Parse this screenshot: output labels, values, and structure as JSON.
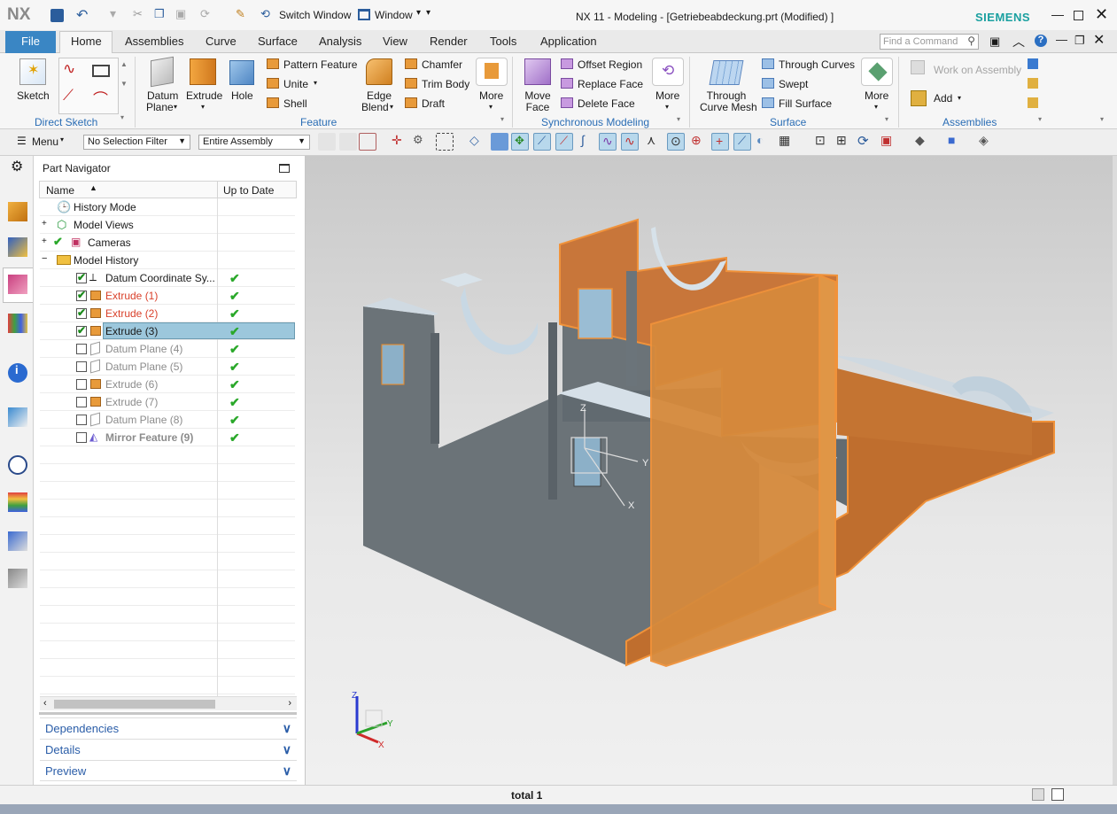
{
  "app": {
    "logo": "NX",
    "title": "NX 11 - Modeling - [Getriebeabdeckung.prt (Modified) ]",
    "brand": "SIEMENS",
    "switch_window": "Switch Window",
    "window_menu": "Window",
    "find_command_placeholder": "Find a Command"
  },
  "tabs": [
    "File",
    "Home",
    "Assemblies",
    "Curve",
    "Surface",
    "Analysis",
    "View",
    "Render",
    "Tools",
    "Application"
  ],
  "ribbon": {
    "direct_sketch": {
      "label": "Direct Sketch",
      "sketch": "Sketch"
    },
    "feature": {
      "label": "Feature",
      "datum_plane": "Datum",
      "datum_plane2": "Plane",
      "extrude": "Extrude",
      "hole": "Hole",
      "pattern": "Pattern Feature",
      "unite": "Unite",
      "shell": "Shell",
      "edge_blend": "Edge",
      "edge_blend2": "Blend",
      "chamfer": "Chamfer",
      "trim_body": "Trim Body",
      "draft": "Draft",
      "more": "More"
    },
    "sync": {
      "label": "Synchronous Modeling",
      "move_face": "Move",
      "move_face2": "Face",
      "offset_region": "Offset Region",
      "replace_face": "Replace Face",
      "delete_face": "Delete Face",
      "more": "More"
    },
    "surface": {
      "label": "Surface",
      "through_curve_mesh": "Through",
      "through_curve_mesh2": "Curve Mesh",
      "through_curves": "Through Curves",
      "swept": "Swept",
      "fill_surface": "Fill Surface",
      "more": "More"
    },
    "assemblies": {
      "label": "Assemblies",
      "work_on_assembly": "Work on Assembly",
      "add": "Add"
    }
  },
  "toolbar2": {
    "menu": "Menu",
    "selection_filter": "No Selection Filter",
    "scope": "Entire Assembly"
  },
  "navigator": {
    "title": "Part Navigator",
    "col_name": "Name",
    "col_uptodate": "Up to Date",
    "rows": [
      {
        "label": "History Mode"
      },
      {
        "label": "Model Views"
      },
      {
        "label": "Cameras"
      },
      {
        "label": "Model History"
      },
      {
        "label": "Datum Coordinate Sy..."
      },
      {
        "label": "Extrude (1)"
      },
      {
        "label": "Extrude (2)"
      },
      {
        "label": "Extrude (3)"
      },
      {
        "label": "Datum Plane (4)"
      },
      {
        "label": "Datum Plane (5)"
      },
      {
        "label": "Extrude (6)"
      },
      {
        "label": "Extrude (7)"
      },
      {
        "label": "Datum Plane (8)"
      },
      {
        "label": "Mirror Feature (9)"
      }
    ],
    "panels": [
      "Dependencies",
      "Details",
      "Preview"
    ]
  },
  "viewport": {
    "axes": {
      "x": "X",
      "y": "Y",
      "z": "Z"
    }
  },
  "status": {
    "text": "total 1"
  },
  "colors": {
    "accent": "#2a6db5",
    "file_tab": "#3a86c4",
    "highlight": "#f0923a",
    "body": "#6b7378"
  }
}
